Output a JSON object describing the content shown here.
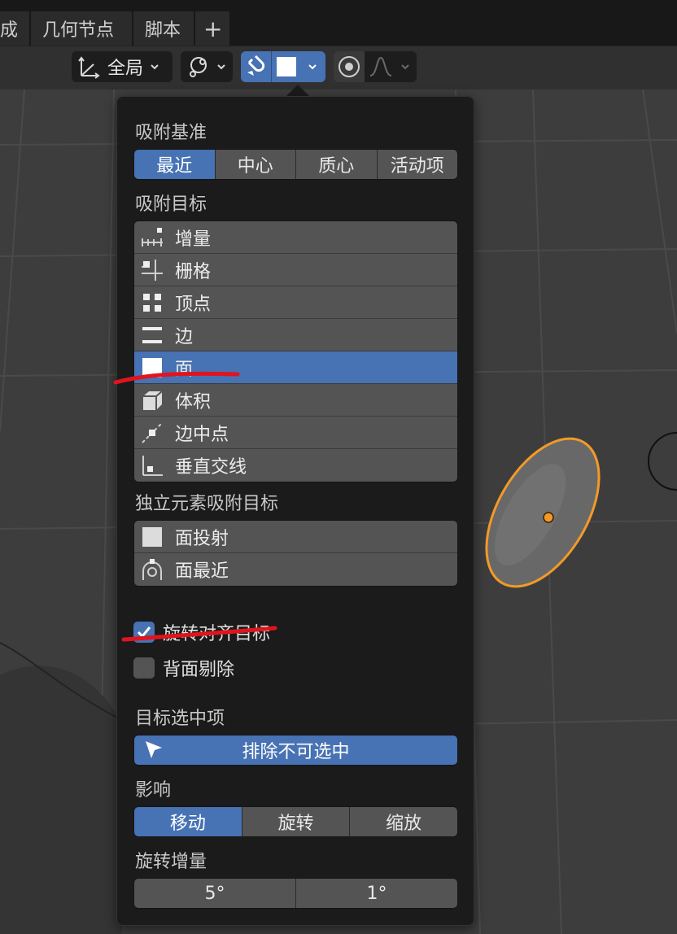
{
  "tabs": [
    {
      "label": "成"
    },
    {
      "label": "几何节点"
    },
    {
      "label": "脚本"
    },
    {
      "label": "+"
    }
  ],
  "header": {
    "orientation_label": "全局"
  },
  "popover": {
    "snap_base": {
      "label": "吸附基准",
      "options": [
        "最近",
        "中心",
        "质心",
        "活动项"
      ],
      "selected": "最近"
    },
    "snap_target": {
      "label": "吸附目标",
      "items": [
        {
          "label": "增量",
          "icon": "increment-icon"
        },
        {
          "label": "栅格",
          "icon": "grid-icon"
        },
        {
          "label": "顶点",
          "icon": "vertex-icon"
        },
        {
          "label": "边",
          "icon": "edge-icon"
        },
        {
          "label": "面",
          "icon": "face-icon"
        },
        {
          "label": "体积",
          "icon": "volume-icon"
        },
        {
          "label": "边中点",
          "icon": "edge-midpoint-icon"
        },
        {
          "label": "垂直交线",
          "icon": "perpendicular-icon"
        }
      ],
      "selected": "面"
    },
    "individual_target": {
      "label": "独立元素吸附目标",
      "items": [
        {
          "label": "面投射",
          "icon": "face-project-icon"
        },
        {
          "label": "面最近",
          "icon": "face-nearest-icon"
        }
      ]
    },
    "align_rotation": {
      "label": "旋转对齐目标",
      "checked": true
    },
    "backface_culling": {
      "label": "背面剔除",
      "checked": false
    },
    "target_selection": {
      "label": "目标选中项",
      "button_label": "排除不可选中"
    },
    "affect": {
      "label": "影响",
      "options": [
        "移动",
        "旋转",
        "缩放"
      ],
      "selected": "移动"
    },
    "rotation_increment": {
      "label": "旋转增量",
      "values": [
        "5°",
        "1°"
      ]
    }
  },
  "colors": {
    "accent": "#4772b3",
    "panel_bg": "#1b1b1b",
    "item_bg": "#545454",
    "selection_outline": "#f29a29",
    "annotation": "#e0141e"
  }
}
